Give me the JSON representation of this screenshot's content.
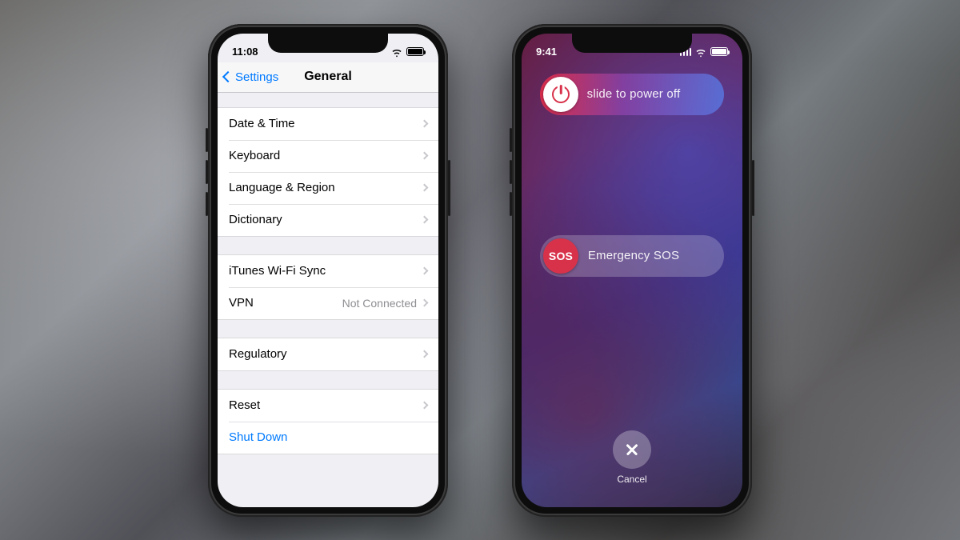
{
  "left": {
    "status": {
      "time": "11:08"
    },
    "nav": {
      "back": "Settings",
      "title": "General"
    },
    "groups": [
      [
        {
          "label": "Date & Time"
        },
        {
          "label": "Keyboard"
        },
        {
          "label": "Language & Region"
        },
        {
          "label": "Dictionary"
        }
      ],
      [
        {
          "label": "iTunes Wi-Fi Sync"
        },
        {
          "label": "VPN",
          "value": "Not Connected"
        }
      ],
      [
        {
          "label": "Regulatory"
        }
      ],
      [
        {
          "label": "Reset"
        },
        {
          "label": "Shut Down",
          "style": "link"
        }
      ]
    ]
  },
  "right": {
    "status": {
      "time": "9:41"
    },
    "power_slider": {
      "label": "slide to power off"
    },
    "sos_slider": {
      "knob": "SOS",
      "label": "Emergency SOS"
    },
    "cancel": {
      "label": "Cancel"
    }
  }
}
